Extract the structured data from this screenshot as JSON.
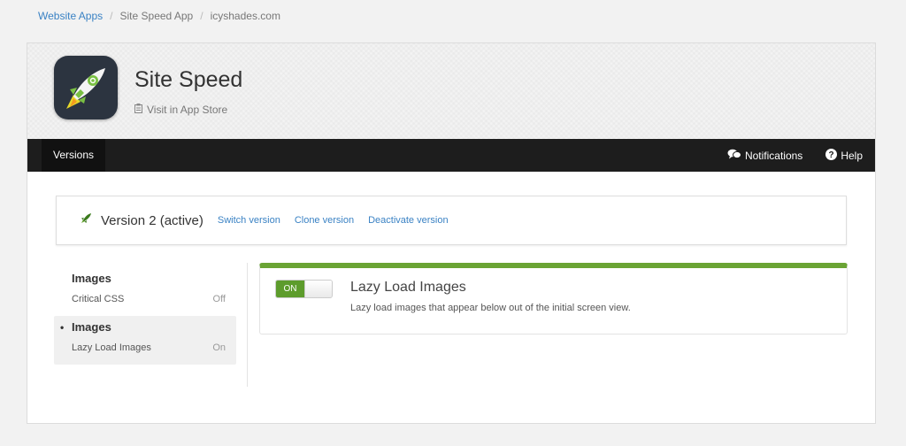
{
  "breadcrumb": {
    "items": [
      "Website Apps",
      "Site Speed App",
      "icyshades.com"
    ],
    "separator": "/"
  },
  "app": {
    "title": "Site Speed",
    "store_link": "Visit in App Store",
    "icon": "rocket-icon"
  },
  "nav": {
    "active_tab": "Versions",
    "notifications": "Notifications",
    "help": "Help"
  },
  "version": {
    "title": "Version 2 (active)",
    "links": [
      "Switch version",
      "Clone version",
      "Deactivate version"
    ]
  },
  "sidebar": {
    "groups": [
      {
        "heading": "Images",
        "row_label": "Critical CSS",
        "row_status": "Off",
        "active": false
      },
      {
        "heading": "Images",
        "row_label": "Lazy Load Images",
        "row_status": "On",
        "active": true
      }
    ]
  },
  "feature": {
    "toggle": "ON",
    "title": "Lazy Load Images",
    "description": "Lazy load images that appear below out of the initial screen view.",
    "enabled": true
  },
  "colors": {
    "accent_green": "#6aa434",
    "link_blue": "#3a82c4",
    "navbar": "#1d1d1d"
  }
}
